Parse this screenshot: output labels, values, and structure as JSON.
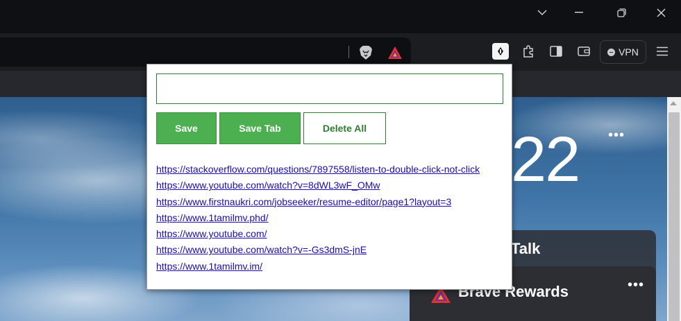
{
  "window": {
    "controls": [
      "chevron-down",
      "minimize",
      "restore",
      "close"
    ]
  },
  "toolbar": {
    "vpn_label": "VPN"
  },
  "new_tab_page": {
    "clock": "22",
    "card_talk_title": "Talk",
    "card_rewards_title": "Brave Rewards"
  },
  "popup": {
    "input_value": "",
    "buttons": {
      "save": "Save",
      "save_tab": "Save Tab",
      "delete_all": "Delete All"
    },
    "links": [
      "https://stackoverflow.com/questions/7897558/listen-to-double-click-not-click",
      "https://www.youtube.com/watch?v=8dWL3wF_OMw",
      "https://www.firstnaukri.com/jobseeker/resume-editor/page1?layout=3",
      "https://www.1tamilmv.phd/",
      "https://www.youtube.com/",
      "https://www.youtube.com/watch?v=-Gs3dmS-jnE",
      "https://www.1tamilmv.im/"
    ]
  },
  "colors": {
    "accent_green": "#4caf50",
    "link_blue": "#1a0dab",
    "dark_chrome": "#1c1d21"
  }
}
